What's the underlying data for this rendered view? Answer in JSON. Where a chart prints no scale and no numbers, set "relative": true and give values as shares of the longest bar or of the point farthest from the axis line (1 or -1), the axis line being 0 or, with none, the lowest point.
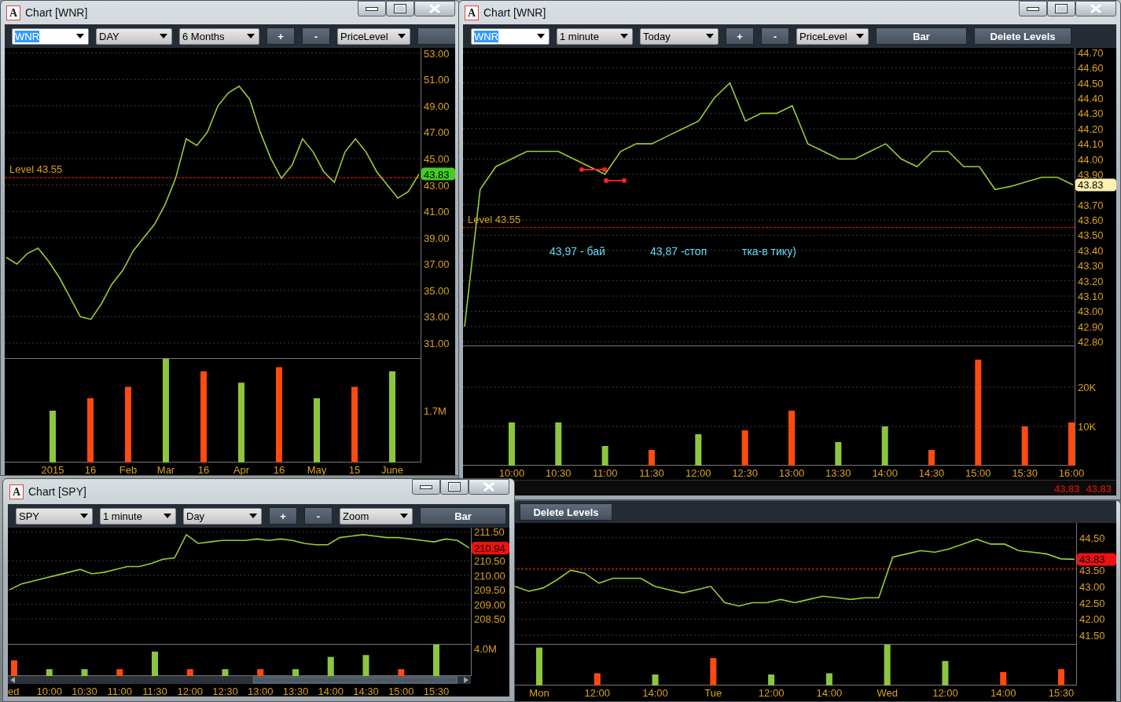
{
  "windows": [
    {
      "title": "Chart [WNR]",
      "icon_letter": "A",
      "toolbar": [
        {
          "kind": "dropdown",
          "value": "WNR",
          "highlighted": true
        },
        {
          "kind": "dropdown",
          "value": "DAY",
          "highlighted": false
        },
        {
          "kind": "dropdown",
          "value": "6 Months",
          "highlighted": false
        },
        {
          "kind": "button",
          "label": "+"
        },
        {
          "kind": "button",
          "label": "-"
        },
        {
          "kind": "dropdown",
          "value": "PriceLevel",
          "highlighted": false
        },
        {
          "kind": "button"
        }
      ],
      "price_chart": {
        "last_price": {
          "label": "43.83",
          "color": "#44cc22"
        },
        "chart_data": {
          "type": "line",
          "grid": true,
          "ylim": [
            29.8,
            53.4
          ],
          "series": [
            {
              "color": "#9acd32",
              "values": [
                37.5,
                37.0,
                37.8,
                38.2,
                37.2,
                36.0,
                34.5,
                33.0,
                32.8,
                34.0,
                35.5,
                36.5,
                38.0,
                39.0,
                40.0,
                41.5,
                43.5,
                46.5,
                46.0,
                47.0,
                49.0,
                50.0,
                50.5,
                49.5,
                47.0,
                45.0,
                43.5,
                44.5,
                46.5,
                45.5,
                44.0,
                43.2,
                45.5,
                46.5,
                45.5,
                44.0,
                43.0,
                42.0,
                42.5,
                43.83
              ]
            }
          ],
          "yticks": [
            {
              "value": 53,
              "label": "53.00"
            },
            {
              "value": 51,
              "label": "51.00"
            },
            {
              "value": 49,
              "label": "49.00"
            },
            {
              "value": 47,
              "label": "47.00"
            },
            {
              "value": 45,
              "label": "45.00"
            },
            {
              "value": 43,
              "label": "43.00"
            },
            {
              "value": 41,
              "label": "41.00"
            },
            {
              "value": 39,
              "label": "39.00"
            },
            {
              "value": 37,
              "label": "37.00"
            },
            {
              "value": 35,
              "label": "35.00"
            },
            {
              "value": 33,
              "label": "33.00"
            },
            {
              "value": 31,
              "label": "31.00"
            }
          ],
          "ref_lines": [
            {
              "axis": "y",
              "value": 43.55,
              "label": "Level 43.55",
              "color": "#ff2020"
            }
          ]
        }
      },
      "volume_chart": {
        "chart_data": {
          "type": "bar",
          "relative": true,
          "categories": [
            "2015",
            "16",
            "Feb",
            "Mar",
            "16",
            "Apr",
            "16",
            "May",
            "15",
            "June"
          ],
          "series": [
            {
              "color": "#8cc63f",
              "values": [
                0.5,
                null,
                null,
                1,
                null,
                0.77,
                null,
                0.62,
                null,
                0.88
              ]
            },
            {
              "color": "#ff4a10",
              "values": [
                null,
                0.62,
                0.73,
                null,
                0.88,
                null,
                0.92,
                null,
                0.73,
                null
              ]
            }
          ],
          "annotations": [
            "1.7M"
          ]
        }
      }
    },
    {
      "title": "Chart [WNR]",
      "icon_letter": "A",
      "toolbar": [
        {
          "kind": "dropdown",
          "value": "WNR",
          "highlighted": true
        },
        {
          "kind": "dropdown",
          "value": "1 minute",
          "highlighted": false
        },
        {
          "kind": "dropdown",
          "value": "Today",
          "highlighted": false
        },
        {
          "kind": "button",
          "label": "+"
        },
        {
          "kind": "button",
          "label": "-"
        },
        {
          "kind": "dropdown",
          "value": "PriceLevel",
          "highlighted": false
        },
        {
          "kind": "button",
          "label": "Bar"
        },
        {
          "kind": "button",
          "label": "Delete Levels"
        }
      ],
      "price_chart": {
        "last_price": {
          "label": "43.83",
          "color": "#fff2b0"
        },
        "markers": true,
        "chart_data": {
          "type": "line",
          "grid": true,
          "ylim": [
            42.77,
            44.73
          ],
          "series": [
            {
              "color": "#9acd32",
              "values": [
                42.9,
                43.8,
                43.95,
                44.0,
                44.05,
                44.05,
                44.05,
                44.0,
                43.95,
                43.9,
                44.05,
                44.1,
                44.1,
                44.15,
                44.2,
                44.25,
                44.4,
                44.5,
                44.25,
                44.3,
                44.3,
                44.35,
                44.1,
                44.05,
                44.0,
                44.0,
                44.05,
                44.1,
                44.0,
                43.95,
                44.05,
                44.05,
                43.95,
                43.95,
                43.8,
                43.82,
                43.85,
                43.88,
                43.88,
                43.83
              ]
            }
          ],
          "yticks": [
            {
              "value": 44.7,
              "label": "44.70"
            },
            {
              "value": 44.6,
              "label": "44.60"
            },
            {
              "value": 44.5,
              "label": "44.50"
            },
            {
              "value": 44.4,
              "label": "44.40"
            },
            {
              "value": 44.3,
              "label": "44.30"
            },
            {
              "value": 44.2,
              "label": "44.20"
            },
            {
              "value": 44.1,
              "label": "44.10"
            },
            {
              "value": 44.0,
              "label": "44.00"
            },
            {
              "value": 43.9,
              "label": "43.90"
            },
            {
              "value": 43.7,
              "label": "43.70"
            },
            {
              "value": 43.6,
              "label": "43.60"
            },
            {
              "value": 43.5,
              "label": "43.50"
            },
            {
              "value": 43.4,
              "label": "43.40"
            },
            {
              "value": 43.3,
              "label": "43.30"
            },
            {
              "value": 43.2,
              "label": "43.20"
            },
            {
              "value": 43.1,
              "label": "43.10"
            },
            {
              "value": 43.0,
              "label": "43.00"
            },
            {
              "value": 42.9,
              "label": "42.90"
            },
            {
              "value": 42.8,
              "label": "42.80"
            }
          ],
          "ref_lines": [
            {
              "axis": "y",
              "value": 43.55,
              "label": "Level 43.55",
              "color": "#ff2020"
            }
          ],
          "annotations": [
            "43,97 -  бай",
            "43,87 -стоп",
            "тка-в тику)"
          ]
        }
      },
      "volume_chart": {
        "chart_data": {
          "type": "bar",
          "grid": true,
          "ylim": [
            0,
            30.4
          ],
          "yticks": [
            {
              "value": 20,
              "label": "20K"
            },
            {
              "value": 10,
              "label": "10K"
            }
          ],
          "categories": [
            "10:00",
            "10:30",
            "11:00",
            "11:30",
            "12:00",
            "12:30",
            "13:00",
            "13:30",
            "14:00",
            "14:30",
            "15:00",
            "15:30",
            "16:00"
          ],
          "series": [
            {
              "color": "#8cc63f",
              "values": [
                11,
                11,
                5,
                null,
                8,
                null,
                null,
                6,
                10,
                null,
                null,
                null,
                null
              ]
            },
            {
              "color": "#ff4a10",
              "values": [
                null,
                null,
                null,
                4,
                null,
                9,
                14,
                null,
                null,
                4,
                27,
                10,
                11
              ]
            }
          ]
        }
      },
      "status_bar": [
        "43.83",
        "43.83"
      ]
    },
    {
      "title": "Chart [SPY]",
      "icon_letter": "A",
      "toolbar": [
        {
          "kind": "dropdown",
          "value": "SPY",
          "highlighted": false
        },
        {
          "kind": "dropdown",
          "value": "1 minute",
          "highlighted": false
        },
        {
          "kind": "dropdown",
          "value": "Day",
          "highlighted": false
        },
        {
          "kind": "button",
          "label": "+"
        },
        {
          "kind": "button",
          "label": "-"
        },
        {
          "kind": "dropdown",
          "value": "Zoom",
          "highlighted": false
        },
        {
          "kind": "button",
          "label": "Bar"
        }
      ],
      "price_chart": {
        "last_price": {
          "label": "210.94",
          "color": "#ee1111"
        },
        "chart_data": {
          "type": "line",
          "grid": true,
          "ylim": [
            207.61,
            211.64
          ],
          "series": [
            {
              "color": "#9acd32",
              "values": [
                209.5,
                209.7,
                209.8,
                209.9,
                210.0,
                210.1,
                210.2,
                210.05,
                210.1,
                210.2,
                210.3,
                210.3,
                210.4,
                210.55,
                210.6,
                211.4,
                211.1,
                211.15,
                211.2,
                211.2,
                211.2,
                211.25,
                211.2,
                211.25,
                211.2,
                211.1,
                211.05,
                211.05,
                211.3,
                211.35,
                211.4,
                211.35,
                211.3,
                211.3,
                211.25,
                211.2,
                211.15,
                211.25,
                211.2,
                210.94
              ]
            }
          ],
          "yticks": [
            {
              "value": 211.5,
              "label": "211.50"
            },
            {
              "value": 210.5,
              "label": "210.50"
            },
            {
              "value": 210.0,
              "label": "210.00"
            },
            {
              "value": 209.5,
              "label": "209.50"
            },
            {
              "value": 209.0,
              "label": "209.00"
            },
            {
              "value": 208.5,
              "label": "208.50"
            }
          ]
        }
      },
      "volume_chart": {
        "chart_data": {
          "type": "bar",
          "relative": true,
          "categories": [
            "ed",
            "10:00",
            "10:30",
            "11:00",
            "11:30",
            "12:00",
            "12:30",
            "13:00",
            "13:30",
            "14:00",
            "14:30",
            "15:00",
            "15:30"
          ],
          "series": [
            {
              "color": "#8cc63f",
              "values": [
                null,
                0.22,
                0.22,
                null,
                0.78,
                null,
                0.22,
                null,
                0.22,
                0.61,
                0.67,
                null,
                1
              ]
            },
            {
              "color": "#ff4a10",
              "values": [
                0.5,
                null,
                null,
                0.22,
                null,
                0.22,
                null,
                0.22,
                null,
                null,
                null,
                0.22,
                null
              ]
            }
          ],
          "annotations": [
            "4.0M"
          ]
        }
      },
      "scrollbar": true
    },
    {
      "toolbar": [
        {
          "kind": "button",
          "label": "Delete Levels"
        }
      ],
      "price_chart": {
        "last_price": {
          "label": "43.83",
          "color": "#ee1111"
        },
        "chart_data": {
          "type": "line",
          "grid": true,
          "ylim": [
            41.21,
            44.95
          ],
          "series": [
            {
              "color": "#9acd32",
              "values": [
                43.0,
                42.85,
                42.95,
                43.2,
                43.5,
                43.4,
                43.1,
                43.25,
                43.25,
                43.25,
                43.0,
                42.9,
                42.8,
                42.9,
                43.0,
                42.5,
                42.4,
                42.5,
                42.5,
                42.6,
                42.5,
                42.6,
                42.7,
                42.65,
                42.6,
                42.65,
                42.65,
                43.9,
                44.0,
                44.1,
                44.05,
                44.15,
                44.3,
                44.45,
                44.3,
                44.3,
                44.1,
                44.05,
                44.0,
                43.85,
                43.83
              ]
            }
          ],
          "yticks": [
            {
              "value": 44.5,
              "label": "44.50"
            },
            {
              "value": 43.5,
              "label": "43.50"
            },
            {
              "value": 43.0,
              "label": "43.00"
            },
            {
              "value": 42.5,
              "label": "42.50"
            },
            {
              "value": 42.0,
              "label": "42.00"
            },
            {
              "value": 41.5,
              "label": "41.50"
            }
          ],
          "ref_lines": [
            {
              "axis": "y",
              "value": 43.55,
              "color": "#ff2020"
            }
          ]
        }
      },
      "volume_chart": {
        "chart_data": {
          "type": "bar",
          "relative": true,
          "categories": [
            "Mon",
            "12:00",
            "14:00",
            "Tue",
            "12:00",
            "14:00",
            "Wed",
            "12:00",
            "14:00",
            "15:30"
          ],
          "series": [
            {
              "color": "#8cc63f",
              "values": [
                0.93,
                null,
                0.27,
                null,
                0.27,
                0.3,
                1,
                0.6,
                null,
                null
              ]
            },
            {
              "color": "#ff4a10",
              "values": [
                null,
                0.3,
                null,
                0.67,
                null,
                null,
                null,
                null,
                0.33,
                0.4
              ]
            }
          ]
        }
      }
    }
  ]
}
